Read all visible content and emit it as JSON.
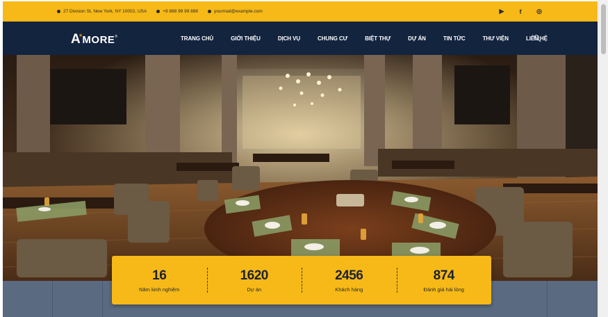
{
  "topbar": {
    "address": "27 Division St, New York, NY 10002, USA",
    "phone": "+9 888 99 99 888",
    "email": "yourmail@example.com",
    "socials": [
      {
        "icon": "youtube-icon",
        "glyph": "▶"
      },
      {
        "icon": "facebook-icon",
        "glyph": "f"
      },
      {
        "icon": "instagram-icon",
        "glyph": "◎"
      }
    ]
  },
  "brand": {
    "logo_a": "A",
    "logo_star": "*",
    "logo_more": "MORE",
    "logo_reg": "®"
  },
  "nav": {
    "items": [
      "TRANG CHỦ",
      "GIỚI THIỆU",
      "DỊCH VỤ",
      "CHUNG CƯ",
      "BIỆT THỰ",
      "DỰ ÁN",
      "TIN TỨC",
      "THƯ VIỆN",
      "LIÊN HỆ"
    ]
  },
  "stats": [
    {
      "value": "16",
      "label": "Năm kinh nghiệm"
    },
    {
      "value": "1620",
      "label": "Dự án"
    },
    {
      "value": "2456",
      "label": "Khách hàng"
    },
    {
      "value": "874",
      "label": "Đánh giá hài lòng"
    }
  ],
  "colors": {
    "accent": "#f6b917",
    "navbar": "#13243f",
    "strip": "#5a6a80"
  }
}
